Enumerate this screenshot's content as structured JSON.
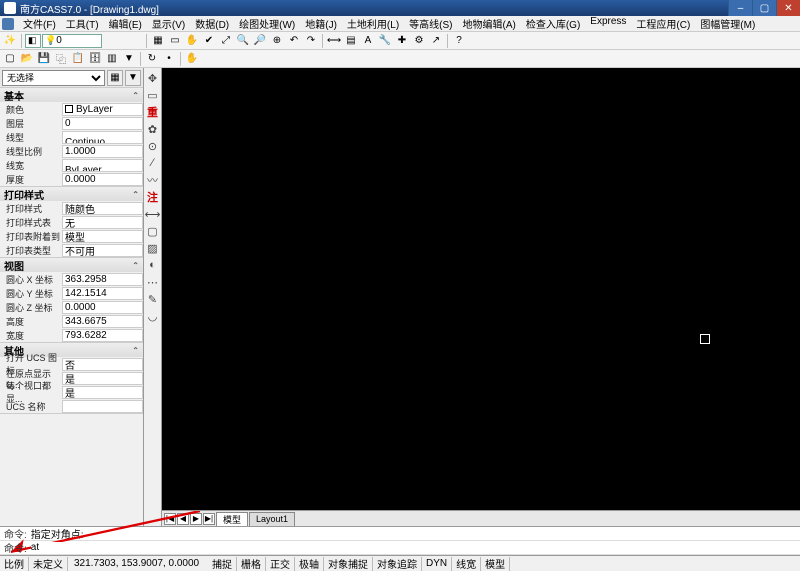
{
  "title": "南方CASS7.0 - [Drawing1.dwg]",
  "menu": [
    "文件(F)",
    "工具(T)",
    "编辑(E)",
    "显示(V)",
    "数据(D)",
    "绘图处理(W)",
    "地籍(J)",
    "土地利用(L)",
    "等高线(S)",
    "地物编辑(A)",
    "检查入库(G)",
    "Express",
    "工程应用(C)",
    "图幅管理(M)"
  ],
  "layer_dropdown": "0",
  "prop_selector": "无选择",
  "sections": {
    "basic": {
      "title": "基本",
      "rows": [
        {
          "label": "颜色",
          "val": "ByLayer",
          "swatch": true
        },
        {
          "label": "图层",
          "val": "0"
        },
        {
          "label": "线型",
          "val": "———— Continuo..."
        },
        {
          "label": "线型比例",
          "val": "1.0000"
        },
        {
          "label": "线宽",
          "val": "———— ByLayer"
        },
        {
          "label": "厚度",
          "val": "0.0000"
        }
      ]
    },
    "print": {
      "title": "打印样式",
      "rows": [
        {
          "label": "打印样式",
          "val": "随颜色"
        },
        {
          "label": "打印样式表",
          "val": "无"
        },
        {
          "label": "打印表附着到",
          "val": "模型"
        },
        {
          "label": "打印表类型",
          "val": "不可用"
        }
      ]
    },
    "view": {
      "title": "视图",
      "rows": [
        {
          "label": "圆心 X 坐标",
          "val": "363.2958"
        },
        {
          "label": "圆心 Y 坐标",
          "val": "142.1514"
        },
        {
          "label": "圆心 Z 坐标",
          "val": "0.0000"
        },
        {
          "label": "高度",
          "val": "343.6675"
        },
        {
          "label": "宽度",
          "val": "793.6282"
        }
      ]
    },
    "other": {
      "title": "其他",
      "rows": [
        {
          "label": "打开 UCS 图标",
          "val": "否"
        },
        {
          "label": "在原点显示 U...",
          "val": "是"
        },
        {
          "label": "每个视口都显...",
          "val": "是"
        },
        {
          "label": "UCS 名称",
          "val": ""
        }
      ]
    }
  },
  "layout_tabs": {
    "nav": [
      "|◀",
      "◀",
      "▶",
      "▶|"
    ],
    "tabs": [
      "模型",
      "Layout1"
    ]
  },
  "cmd": {
    "prompt1": "命令:",
    "hist": "指定对角点:",
    "prompt2": "命令:",
    "input": "at"
  },
  "status": {
    "scale_label": "比例",
    "scale_val": "未定义",
    "coords": "321.7303, 153.9007, 0.0000",
    "toggles": [
      "捕捉",
      "栅格",
      "正交",
      "极轴",
      "对象捕捉",
      "对象追踪",
      "DYN",
      "线宽",
      "模型"
    ]
  }
}
